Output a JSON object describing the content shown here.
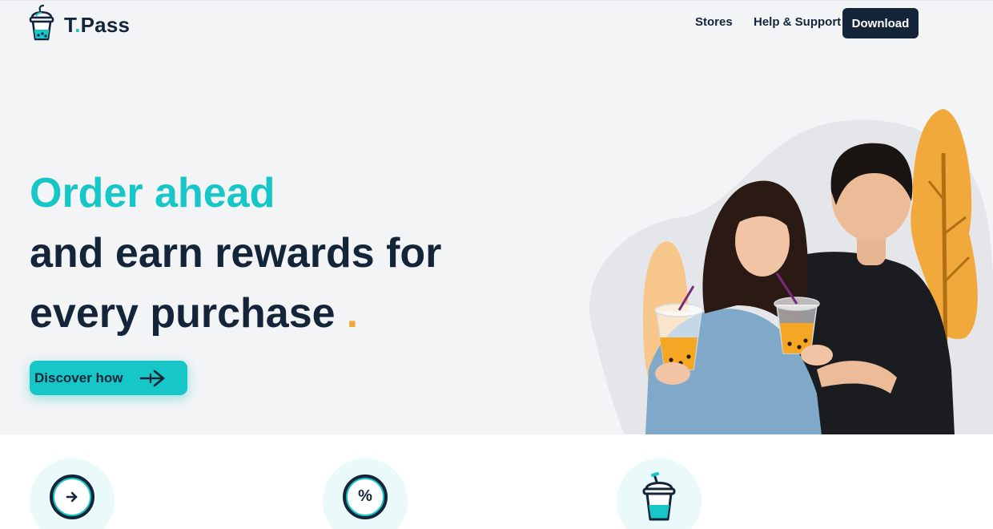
{
  "brand": {
    "name_prefix": "T",
    "name_dot": ".",
    "name_suffix": "Pass",
    "logo_icon": "bubble-tea-cup-icon",
    "accent_color": "#17c6c6",
    "dark_color": "#14253a",
    "highlight_color": "#f1a93b"
  },
  "nav": {
    "links": [
      {
        "label": "Stores"
      },
      {
        "label": "Help & Support"
      }
    ],
    "download_label": "Download"
  },
  "hero": {
    "line1": "Order ahead",
    "line2": "and earn rewards for",
    "line3": "every purchase",
    "dot": ".",
    "cta_label": "Discover how",
    "cta_icon": "arrow-right-icon",
    "image_alt": "couple-with-bubble-tea"
  },
  "features": [
    {
      "icon": "arrow-circle-icon"
    },
    {
      "icon": "percent-icon",
      "glyph": "%"
    },
    {
      "icon": "bubble-tea-cup-icon"
    }
  ]
}
